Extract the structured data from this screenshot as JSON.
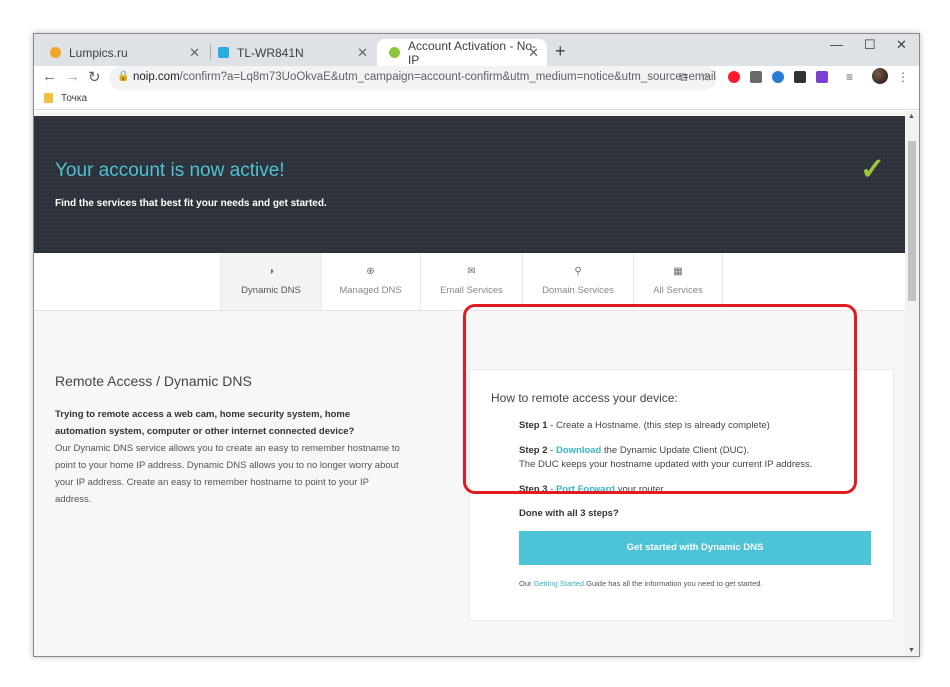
{
  "browser": {
    "tabs": [
      {
        "title": "Lumpics.ru",
        "favicon_color": "#f4a62a"
      },
      {
        "title": "TL-WR841N",
        "favicon_color": "#27aee0"
      },
      {
        "title": "Account Activation - No-IP",
        "favicon_color": "#8cc63f"
      }
    ],
    "new_tab": "+",
    "window_controls": {
      "minimize": "—",
      "maximize": "☐",
      "close": "✕"
    },
    "nav": {
      "back": "←",
      "forward": "→",
      "reload": "↻"
    },
    "url": {
      "host": "noip.com",
      "path": "/confirm?a=Lq8m73UoOkvaE&utm_campaign=account-confirm&utm_medium=notice&utm_source=email"
    },
    "bookmarks": [
      {
        "label": "Точка"
      }
    ]
  },
  "hero": {
    "title": "Your account is now active!",
    "subtitle": "Find the services that best fit your needs and get started.",
    "check": "✓"
  },
  "service_tabs": [
    {
      "label": "Dynamic DNS",
      "icon": "◑"
    },
    {
      "label": "Managed DNS",
      "icon": "⊕"
    },
    {
      "label": "Email Services",
      "icon": "✉"
    },
    {
      "label": "Domain Services",
      "icon": "⚲"
    },
    {
      "label": "All Services",
      "icon": "▦"
    }
  ],
  "left": {
    "title": "Remote Access / Dynamic DNS",
    "bold_text": "Trying to remote access a web cam, home security system, home automation system, computer or other internet connected device?",
    "body": "Our Dynamic DNS service allows you to create an easy to remember hostname to point to your home IP address. Dynamic DNS allows you to no longer worry about your IP address. Create an easy to remember hostname to point to your IP address."
  },
  "card": {
    "title": "How to remote access your device:",
    "step1": {
      "label": "Step 1",
      "text": " - Create a Hostname. (this step is already complete)"
    },
    "step2": {
      "label": "Step 2",
      "sep": " - ",
      "link": "Download",
      "text": " the Dynamic Update Client (DUC).",
      "line2": "The DUC keeps your hostname updated with your current IP address."
    },
    "step3": {
      "label": "Step 3",
      "sep": " - ",
      "link": "Port Forward",
      "text": " your router."
    },
    "done": "Done with all 3 steps?",
    "cta": "Get started with Dynamic DNS",
    "footer": {
      "pre": "Our ",
      "link": "Getting Started",
      "post": " Guide has all the information you need to get started."
    }
  },
  "colors": {
    "accent": "#4cc3d6",
    "hero_bg": "#2c313a",
    "highlight": "#e01c22",
    "check": "#9bc53d"
  }
}
